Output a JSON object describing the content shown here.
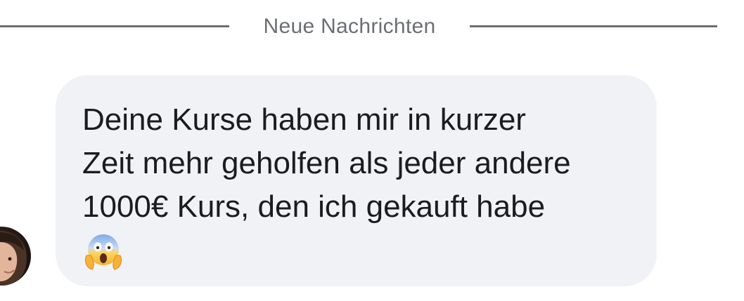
{
  "divider": {
    "label": "Neue Nachrichten"
  },
  "message": {
    "lines": [
      "Deine Kurse haben mir in kurzer",
      "Zeit mehr geholfen als jeder andere",
      "1000€ Kurs, den ich gekauft habe"
    ],
    "emoji": "face-screaming-in-fear-icon"
  },
  "colors": {
    "divider": "#6b6e73",
    "bubble_bg": "#f1f2f5",
    "text": "#1c1c1e"
  }
}
